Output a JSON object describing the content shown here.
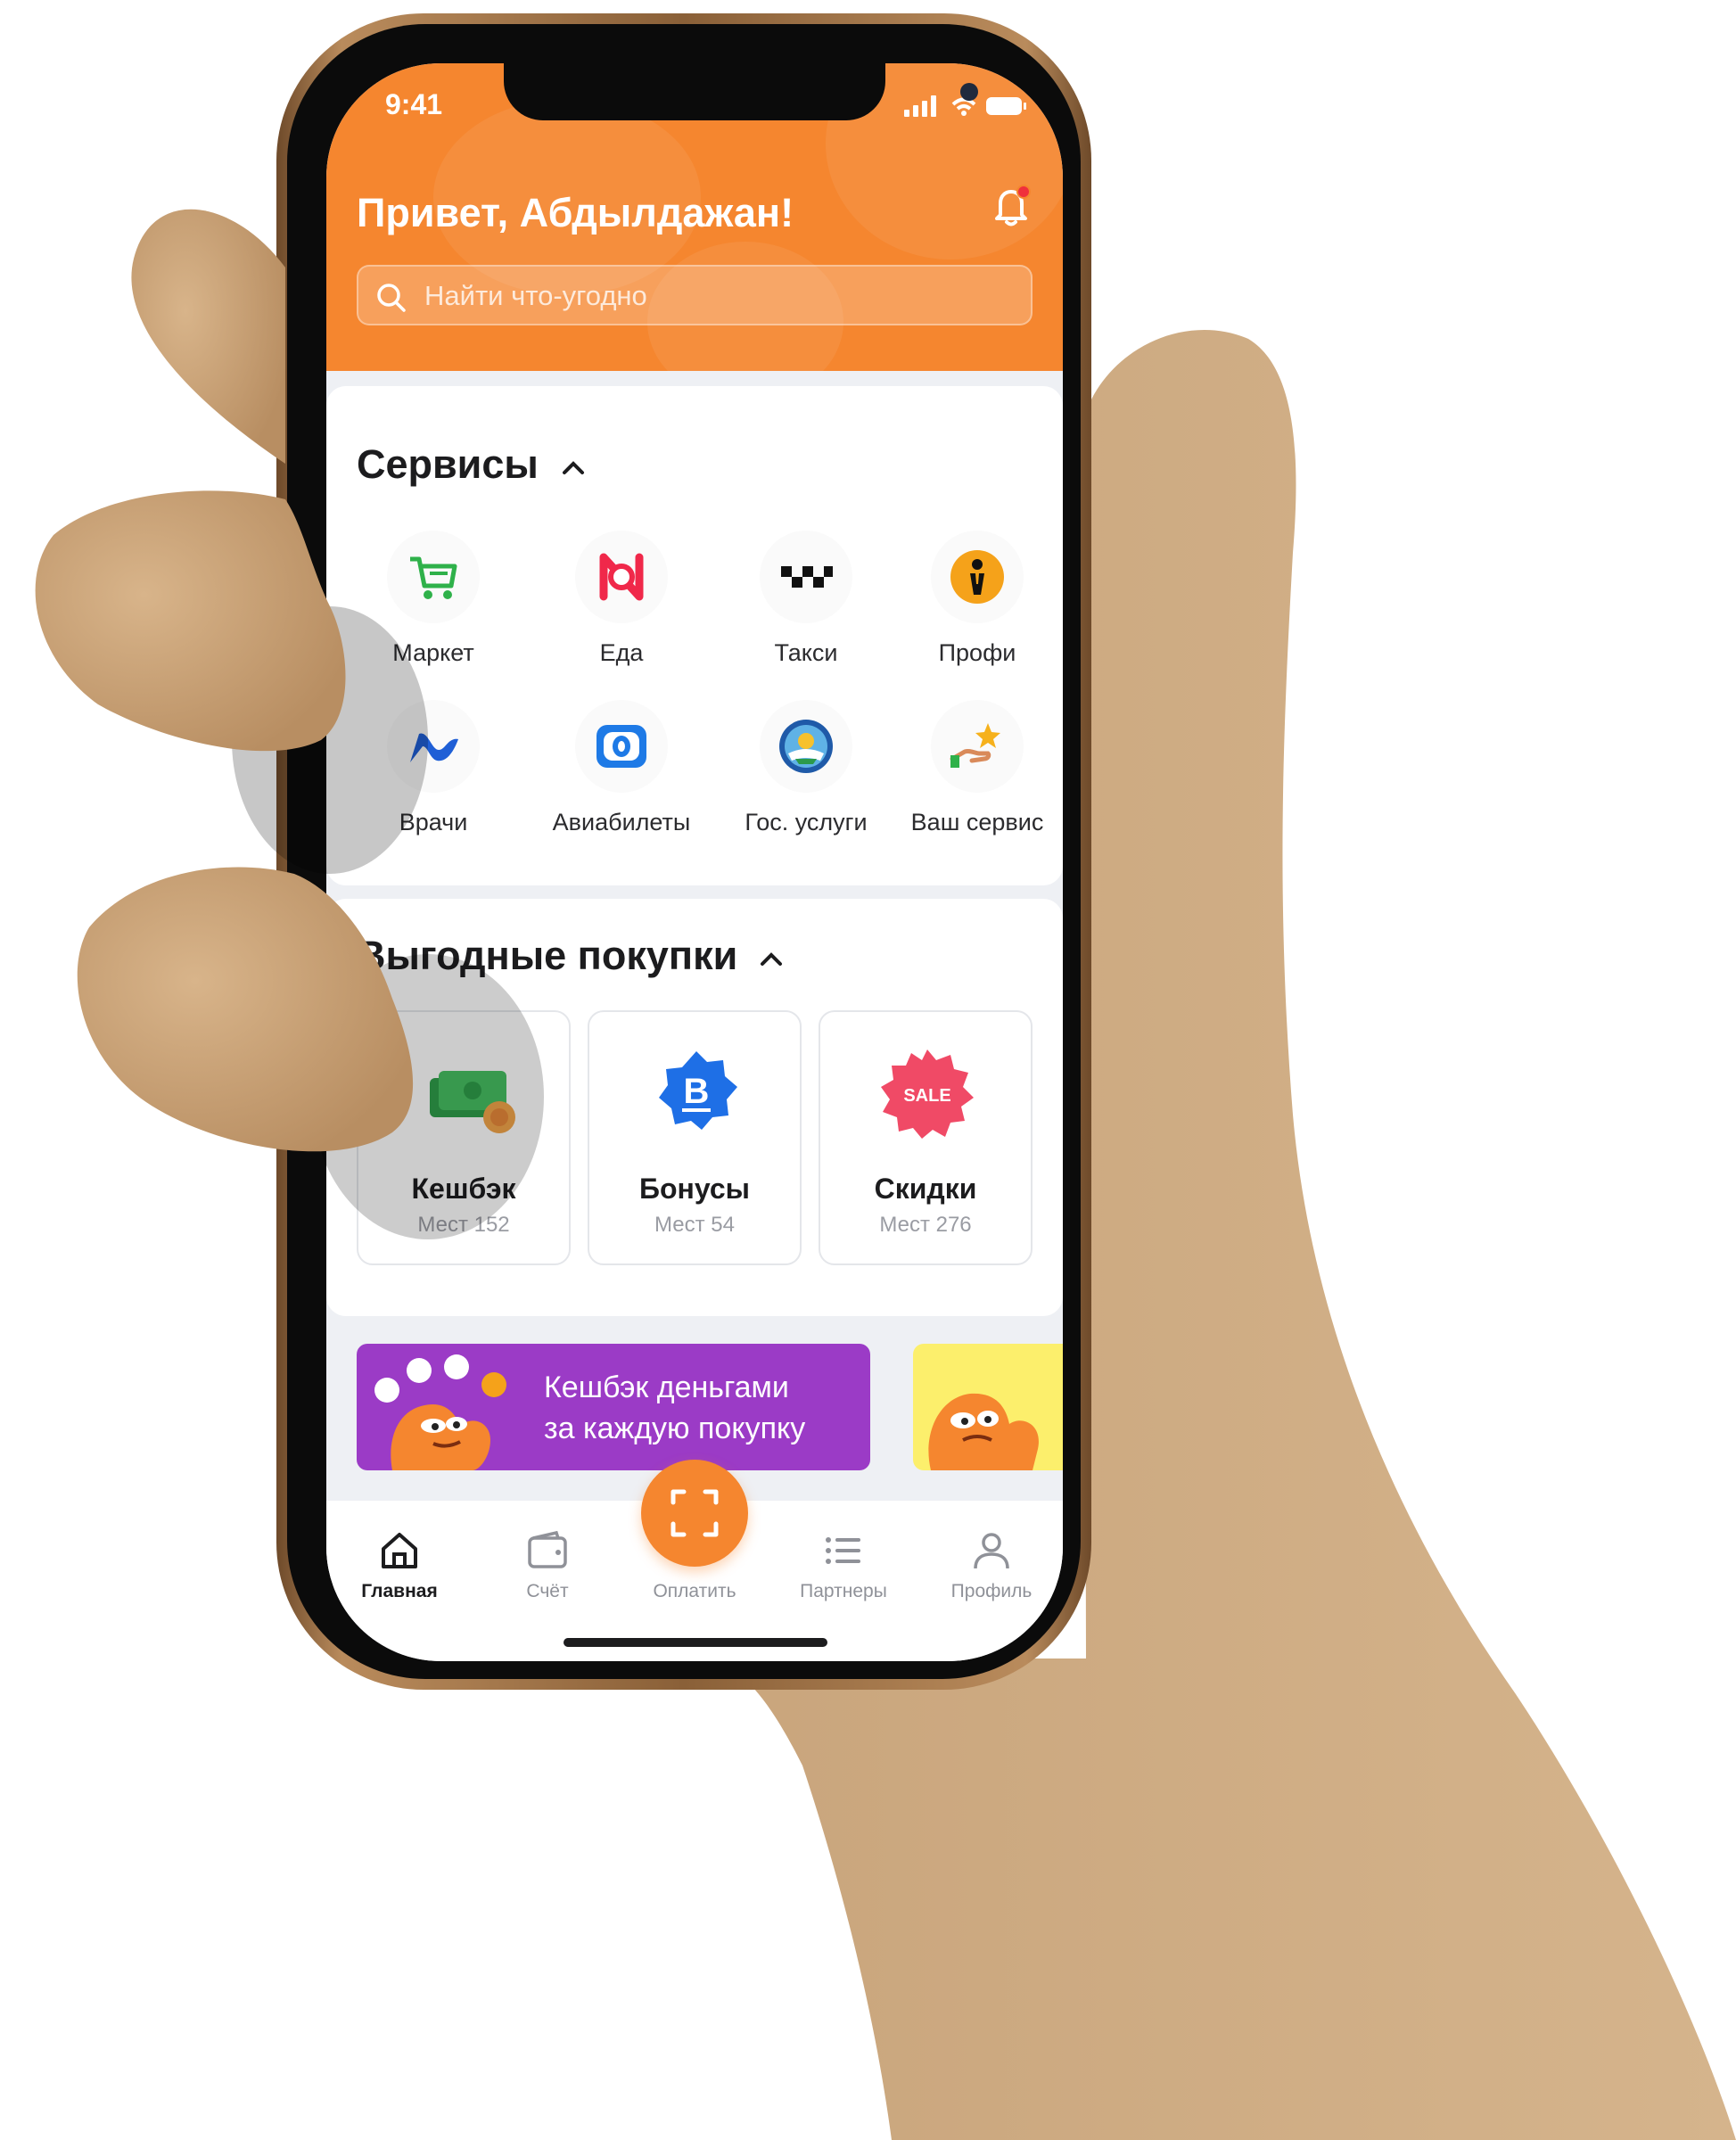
{
  "status_bar": {
    "time": "9:41"
  },
  "header": {
    "greeting": "Привет, Абдылдажан!",
    "search_placeholder": "Найти что-угодно",
    "accent": "#f5862f"
  },
  "services": {
    "title": "Сервисы",
    "items": [
      {
        "label": "Маркет",
        "icon": "cart-icon"
      },
      {
        "label": "Еда",
        "icon": "food-icon"
      },
      {
        "label": "Такси",
        "icon": "taxi-icon"
      },
      {
        "label": "Профи",
        "icon": "profi-icon"
      },
      {
        "label": "Врачи",
        "icon": "doctors-icon"
      },
      {
        "label": "Авиабилеты",
        "icon": "flights-icon"
      },
      {
        "label": "Гос. услуги",
        "icon": "gov-emblem-icon"
      },
      {
        "label": "Ваш сервис",
        "icon": "your-service-icon"
      }
    ]
  },
  "deals": {
    "title": "Выгодные покупки",
    "items": [
      {
        "title": "Кешбэк",
        "subtitle": "Мест 152",
        "icon": "cashback-icon"
      },
      {
        "title": "Бонусы",
        "subtitle": "Мест 54",
        "icon": "bonus-icon"
      },
      {
        "title": "Скидки",
        "subtitle": "Мест 276",
        "icon": "sale-icon",
        "badge": "SALE"
      }
    ]
  },
  "banners": [
    {
      "line1": "Кешбэк деньгами",
      "line2": "за каждую покупку",
      "color": "#9b3bc6"
    },
    {
      "color": "#fcef6c"
    }
  ],
  "tabbar": {
    "items": [
      {
        "label": "Главная",
        "active": true
      },
      {
        "label": "Счёт"
      },
      {
        "label": "Оплатить"
      },
      {
        "label": "Партнеры"
      },
      {
        "label": "Профиль"
      }
    ]
  }
}
